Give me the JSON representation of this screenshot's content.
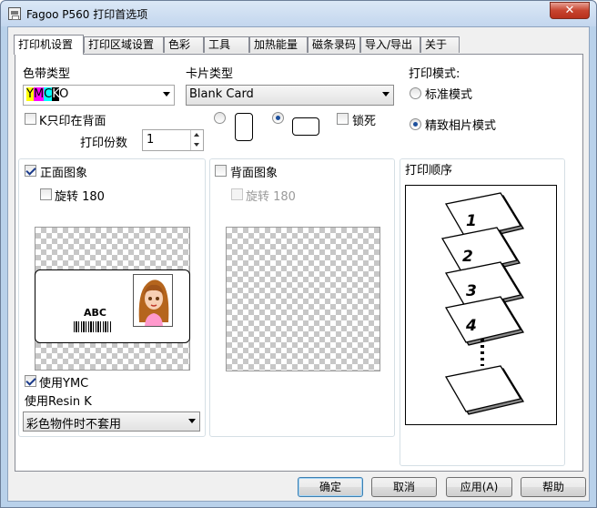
{
  "window": {
    "title": "Fagoo P560 打印首选项",
    "close_glyph": "✕"
  },
  "tabs": [
    "打印机设置",
    "打印区域设置",
    "色彩",
    "工具",
    "加热能量",
    "磁条录码",
    "导入/导出",
    "关于"
  ],
  "ribbon_type": {
    "label": "色带类型",
    "letters": [
      "Y",
      "M",
      "C",
      "K",
      "O"
    ],
    "letter_colors": [
      "#ffff00",
      "#ff00ff",
      "#00ffff",
      "#000000",
      "#ffffff"
    ]
  },
  "card_type": {
    "label": "卡片类型",
    "value": "Blank Card"
  },
  "print_mode": {
    "label": "打印模式:",
    "options": [
      {
        "label": "标准模式",
        "selected": false
      },
      {
        "label": "精致相片模式",
        "selected": true
      }
    ]
  },
  "k_back_only": {
    "label": "K只印在背面",
    "checked": false
  },
  "orientation": {
    "portrait_selected": false,
    "landscape_selected": true
  },
  "lock": {
    "label": "锁死",
    "checked": false
  },
  "copies": {
    "label": "打印份数",
    "value": "1"
  },
  "front_image": {
    "label": "正面图象",
    "checked": true,
    "rotate_label": "旋转 180",
    "rotate_checked": false
  },
  "back_image": {
    "label": "背面图象",
    "checked": false,
    "rotate_label": "旋转 180",
    "rotate_checked": false
  },
  "sample_card": {
    "text": "ABC"
  },
  "use_ymc": {
    "label": "使用YMC",
    "checked": true
  },
  "use_resin_k": {
    "label": "使用Resin K"
  },
  "resin_k_option": {
    "value": "彩色物件时不套用"
  },
  "print_order": {
    "label": "打印顺序",
    "numbers": [
      "1",
      "2",
      "3",
      "4"
    ]
  },
  "buttons": {
    "ok": "确定",
    "cancel": "取消",
    "apply": "应用(A)",
    "help": "帮助"
  },
  "colors": {
    "accent_radio": "#1c4f9c",
    "title_bar": "#c3d6ee",
    "close_button": "#c7442f"
  }
}
